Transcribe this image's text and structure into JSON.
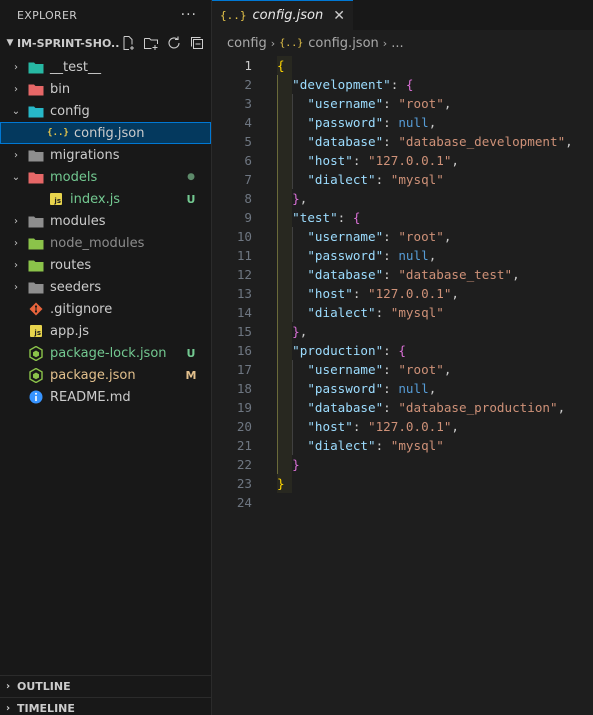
{
  "explorer": {
    "title": "EXPLORER",
    "more": "···",
    "folder_name": "IM-SPRINT-SHO...",
    "items": [
      {
        "label": "__test__",
        "type": "folder",
        "expanded": false,
        "icon": "test-folder-icon",
        "icon_color": "#27b8a3",
        "color": "#cccccc",
        "badge": "",
        "depth": 0
      },
      {
        "label": "bin",
        "type": "folder",
        "expanded": false,
        "icon": "bin-folder-icon",
        "icon_color": "#e66767",
        "color": "#cccccc",
        "badge": "",
        "depth": 0
      },
      {
        "label": "config",
        "type": "folder",
        "expanded": true,
        "icon": "config-folder-icon",
        "icon_color": "#27b8c8",
        "color": "#cccccc",
        "badge": "",
        "depth": 0
      },
      {
        "label": "config.json",
        "type": "file",
        "icon": "json-icon",
        "icon_color": "#e8c64a",
        "color": "#cccccc",
        "badge": "",
        "depth": 1,
        "selected": true
      },
      {
        "label": "migrations",
        "type": "folder",
        "expanded": false,
        "icon": "folder-icon",
        "icon_color": "#8e8e8e",
        "color": "#cccccc",
        "badge": "",
        "depth": 0
      },
      {
        "label": "models",
        "type": "folder",
        "expanded": true,
        "icon": "models-folder-icon",
        "icon_color": "#e66767",
        "color": "#73c991",
        "badge": "●",
        "badge_color": "#5d8a6a",
        "depth": 0
      },
      {
        "label": "index.js",
        "type": "file",
        "icon": "js-icon",
        "icon_color": "#e8d44d",
        "color": "#73c991",
        "badge": "U",
        "badge_color": "#73c991",
        "depth": 1
      },
      {
        "label": "modules",
        "type": "folder",
        "expanded": false,
        "icon": "folder-icon",
        "icon_color": "#8e8e8e",
        "color": "#cccccc",
        "badge": "",
        "depth": 0
      },
      {
        "label": "node_modules",
        "type": "folder",
        "expanded": false,
        "icon": "node-folder-icon",
        "icon_color": "#8bc34a",
        "color": "#8c8c8c",
        "badge": "",
        "depth": 0
      },
      {
        "label": "routes",
        "type": "folder",
        "expanded": false,
        "icon": "routes-folder-icon",
        "icon_color": "#8bc34a",
        "color": "#cccccc",
        "badge": "",
        "depth": 0
      },
      {
        "label": "seeders",
        "type": "folder",
        "expanded": false,
        "icon": "folder-icon",
        "icon_color": "#8e8e8e",
        "color": "#cccccc",
        "badge": "",
        "depth": 0
      },
      {
        "label": ".gitignore",
        "type": "file",
        "icon": "git-icon",
        "icon_color": "#e8643c",
        "color": "#cccccc",
        "badge": "",
        "depth": 0
      },
      {
        "label": "app.js",
        "type": "file",
        "icon": "js-icon",
        "icon_color": "#e8d44d",
        "color": "#cccccc",
        "badge": "",
        "depth": 0
      },
      {
        "label": "package-lock.json",
        "type": "file",
        "icon": "node-icon",
        "icon_color": "#8bc34a",
        "color": "#73c991",
        "badge": "U",
        "badge_color": "#73c991",
        "depth": 0
      },
      {
        "label": "package.json",
        "type": "file",
        "icon": "node-icon",
        "icon_color": "#8bc34a",
        "color": "#e2c08d",
        "badge": "M",
        "badge_color": "#e2c08d",
        "depth": 0
      },
      {
        "label": "README.md",
        "type": "file",
        "icon": "info-icon",
        "icon_color": "#3794ff",
        "color": "#cccccc",
        "badge": "",
        "depth": 0
      }
    ]
  },
  "panels": {
    "outline": "OUTLINE",
    "timeline": "TIMELINE"
  },
  "tab": {
    "icon_text": "{..}",
    "label": "config.json",
    "close": "✕"
  },
  "breadcrumb": {
    "parts": [
      "config",
      "config.json",
      "..."
    ],
    "icon_text": "{..}"
  },
  "code": {
    "active_line": 1,
    "lines": [
      [
        [
          "b1",
          "{"
        ]
      ],
      [
        [
          "p",
          "  "
        ],
        [
          "k",
          "\"development\""
        ],
        [
          "p",
          ": "
        ],
        [
          "b2",
          "{"
        ]
      ],
      [
        [
          "p",
          "    "
        ],
        [
          "k",
          "\"username\""
        ],
        [
          "p",
          ": "
        ],
        [
          "s",
          "\"root\""
        ],
        [
          "p",
          ","
        ]
      ],
      [
        [
          "p",
          "    "
        ],
        [
          "k",
          "\"password\""
        ],
        [
          "p",
          ": "
        ],
        [
          "n",
          "null"
        ],
        [
          "p",
          ","
        ]
      ],
      [
        [
          "p",
          "    "
        ],
        [
          "k",
          "\"database\""
        ],
        [
          "p",
          ": "
        ],
        [
          "s",
          "\"database_development\""
        ],
        [
          "p",
          ","
        ]
      ],
      [
        [
          "p",
          "    "
        ],
        [
          "k",
          "\"host\""
        ],
        [
          "p",
          ": "
        ],
        [
          "s",
          "\"127.0.0.1\""
        ],
        [
          "p",
          ","
        ]
      ],
      [
        [
          "p",
          "    "
        ],
        [
          "k",
          "\"dialect\""
        ],
        [
          "p",
          ": "
        ],
        [
          "s",
          "\"mysql\""
        ]
      ],
      [
        [
          "p",
          "  "
        ],
        [
          "b2",
          "}"
        ],
        [
          "p",
          ","
        ]
      ],
      [
        [
          "p",
          "  "
        ],
        [
          "k",
          "\"test\""
        ],
        [
          "p",
          ": "
        ],
        [
          "b2",
          "{"
        ]
      ],
      [
        [
          "p",
          "    "
        ],
        [
          "k",
          "\"username\""
        ],
        [
          "p",
          ": "
        ],
        [
          "s",
          "\"root\""
        ],
        [
          "p",
          ","
        ]
      ],
      [
        [
          "p",
          "    "
        ],
        [
          "k",
          "\"password\""
        ],
        [
          "p",
          ": "
        ],
        [
          "n",
          "null"
        ],
        [
          "p",
          ","
        ]
      ],
      [
        [
          "p",
          "    "
        ],
        [
          "k",
          "\"database\""
        ],
        [
          "p",
          ": "
        ],
        [
          "s",
          "\"database_test\""
        ],
        [
          "p",
          ","
        ]
      ],
      [
        [
          "p",
          "    "
        ],
        [
          "k",
          "\"host\""
        ],
        [
          "p",
          ": "
        ],
        [
          "s",
          "\"127.0.0.1\""
        ],
        [
          "p",
          ","
        ]
      ],
      [
        [
          "p",
          "    "
        ],
        [
          "k",
          "\"dialect\""
        ],
        [
          "p",
          ": "
        ],
        [
          "s",
          "\"mysql\""
        ]
      ],
      [
        [
          "p",
          "  "
        ],
        [
          "b2",
          "}"
        ],
        [
          "p",
          ","
        ]
      ],
      [
        [
          "p",
          "  "
        ],
        [
          "k",
          "\"production\""
        ],
        [
          "p",
          ": "
        ],
        [
          "b2",
          "{"
        ]
      ],
      [
        [
          "p",
          "    "
        ],
        [
          "k",
          "\"username\""
        ],
        [
          "p",
          ": "
        ],
        [
          "s",
          "\"root\""
        ],
        [
          "p",
          ","
        ]
      ],
      [
        [
          "p",
          "    "
        ],
        [
          "k",
          "\"password\""
        ],
        [
          "p",
          ": "
        ],
        [
          "n",
          "null"
        ],
        [
          "p",
          ","
        ]
      ],
      [
        [
          "p",
          "    "
        ],
        [
          "k",
          "\"database\""
        ],
        [
          "p",
          ": "
        ],
        [
          "s",
          "\"database_production\""
        ],
        [
          "p",
          ","
        ]
      ],
      [
        [
          "p",
          "    "
        ],
        [
          "k",
          "\"host\""
        ],
        [
          "p",
          ": "
        ],
        [
          "s",
          "\"127.0.0.1\""
        ],
        [
          "p",
          ","
        ]
      ],
      [
        [
          "p",
          "    "
        ],
        [
          "k",
          "\"dialect\""
        ],
        [
          "p",
          ": "
        ],
        [
          "s",
          "\"mysql\""
        ]
      ],
      [
        [
          "p",
          "  "
        ],
        [
          "b2",
          "}"
        ]
      ],
      [
        [
          "b1",
          "}"
        ]
      ],
      []
    ]
  }
}
